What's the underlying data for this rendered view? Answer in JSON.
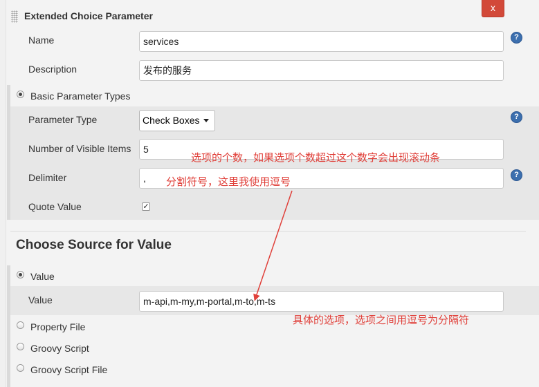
{
  "panel": {
    "close_label": "x",
    "title": "Extended Choice Parameter"
  },
  "fields": {
    "name_label": "Name",
    "name_value": "services",
    "description_label": "Description",
    "description_value": "发布的服务"
  },
  "basic": {
    "radio_label": "Basic Parameter Types",
    "parameter_type_label": "Parameter Type",
    "parameter_type_value": "Check Boxes",
    "visible_items_label": "Number of Visible Items",
    "visible_items_value": "5",
    "delimiter_label": "Delimiter",
    "delimiter_value": ",",
    "quote_value_label": "Quote Value",
    "quote_value_checked": true
  },
  "source": {
    "heading": "Choose Source for Value",
    "value_radio_label": "Value",
    "value_label": "Value",
    "value_value": "m-api,m-my,m-portal,m-to,m-ts",
    "property_file_label": "Property File",
    "groovy_script_label": "Groovy Script",
    "groovy_script_file_label": "Groovy Script File"
  },
  "annotations": {
    "visible_items_note": "选项的个数，如果选项个数超过这个数字会出现滚动条",
    "delimiter_note": "分割符号，这里我使用逗号",
    "value_note": "具体的选项，选项之间用逗号为分隔符",
    "color": "#e0403a"
  },
  "help_glyph": "?"
}
